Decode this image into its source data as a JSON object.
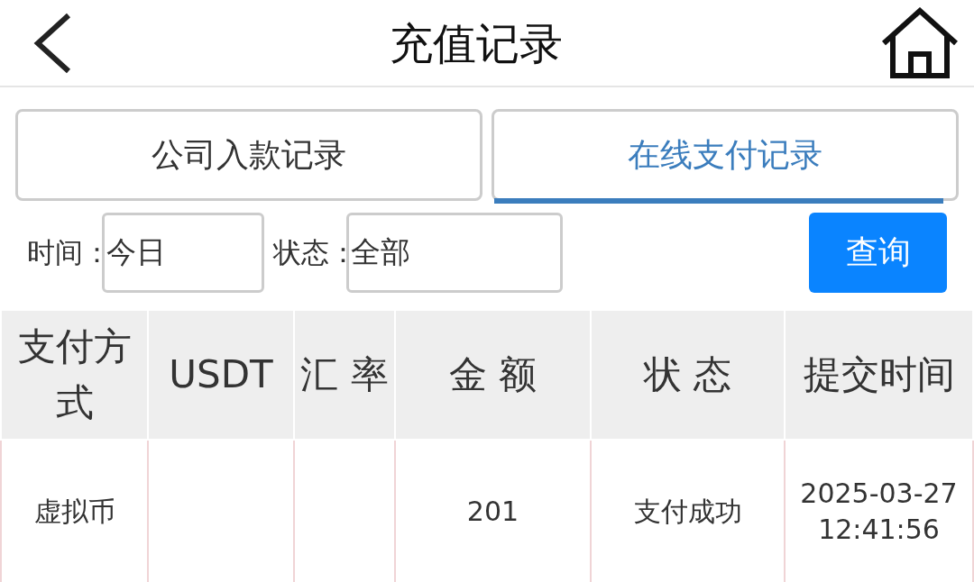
{
  "header": {
    "title": "充值记录"
  },
  "tabs": [
    {
      "label": "公司入款记录",
      "selected": false
    },
    {
      "label": "在线支付记录",
      "selected": true
    }
  ],
  "filters": {
    "time_label": "时间：",
    "time_value": "今日",
    "status_label": "状态：",
    "status_value": "全部",
    "query_button": "查询"
  },
  "table": {
    "columns": [
      "支付方式",
      "USDT",
      "汇 率",
      "金 额",
      "状 态",
      "提交时间"
    ],
    "rows": [
      {
        "cells": [
          "虚拟币",
          null,
          null,
          "201",
          "支付成功",
          "2025-03-27 12:41:56"
        ]
      }
    ]
  }
}
